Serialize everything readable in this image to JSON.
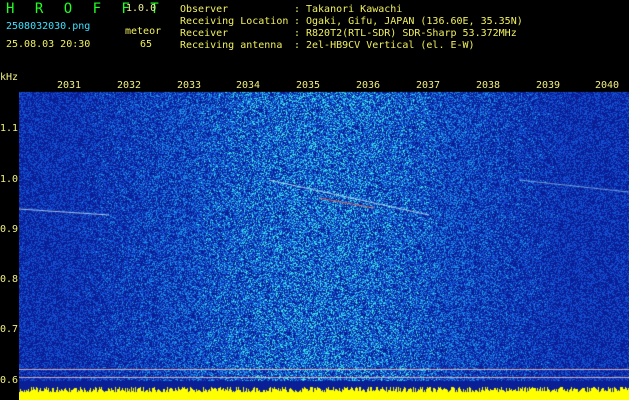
{
  "app": {
    "title": "H R O F F T",
    "version": "1.0.0"
  },
  "file": {
    "name": "2508032030.png",
    "timestamp": "25.08.03 20:30"
  },
  "meteor": {
    "label": "meteor",
    "count": "65"
  },
  "info": [
    {
      "key": "Observer",
      "sep": ":",
      "value": "Takanori Kawachi"
    },
    {
      "key": "Receiving Location",
      "sep": ":",
      "value": "Ogaki, Gifu, JAPAN (136.60E, 35.35N)"
    },
    {
      "key": "Receiver",
      "sep": ":",
      "value": "R820T2(RTL-SDR) SDR-Sharp 53.372MHz"
    },
    {
      "key": "Receiving antenna",
      "sep": ":",
      "value": "2el-HB9CV Vertical (el. E-W)"
    }
  ],
  "y_unit": "kHz",
  "y_ticks": [
    "1.1",
    "1.0",
    "0.9",
    "0.8",
    "0.7",
    "0.6"
  ],
  "time_ticks": [
    "2031",
    "2032",
    "2033",
    "2034",
    "2035",
    "2036",
    "2037",
    "2038",
    "2039",
    "2040"
  ],
  "colors": {
    "bg": "#000000",
    "low": "#0a1a8c",
    "mid": "#1a5cd8",
    "high": "#30e8e8",
    "peak": "#ffffff",
    "floor": "#ffff00"
  }
}
